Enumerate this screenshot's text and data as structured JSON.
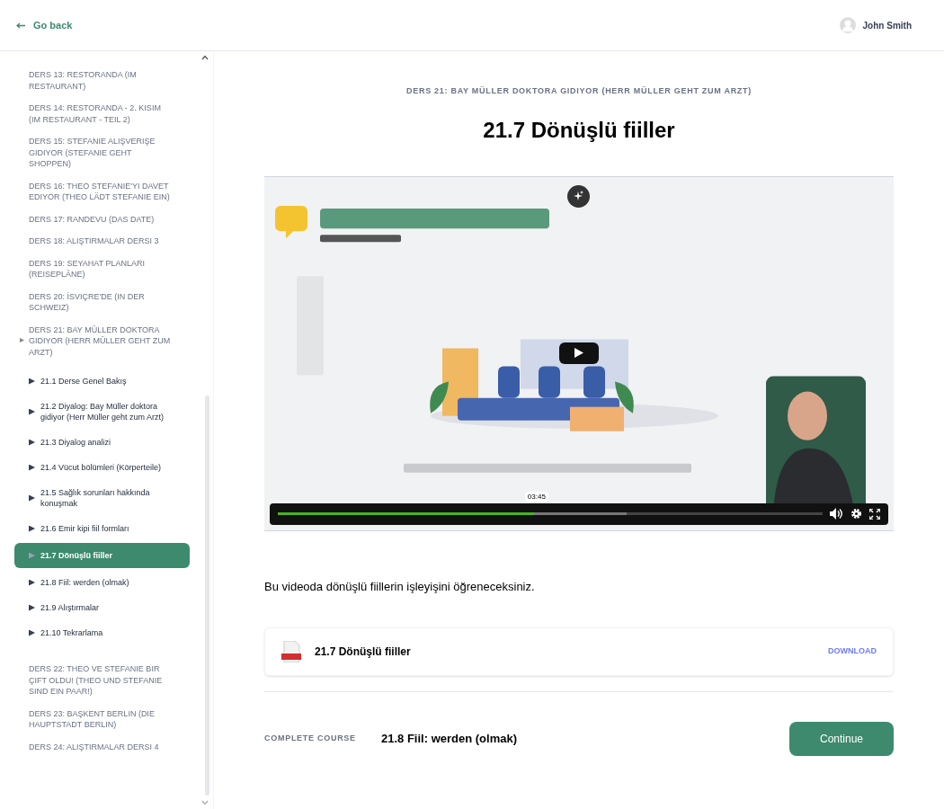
{
  "header": {
    "back_link": "Go back",
    "user_name": "John Smith"
  },
  "sidebar": {
    "lessons": [
      {
        "title": "DERS 13: RESTORANDA (IM RESTAURANT)",
        "expanded": false
      },
      {
        "title": "DERS 14: RESTORANDA - 2. KISIM (IM RESTAURANT - TEIL 2)",
        "expanded": false
      },
      {
        "title": "DERS 15: STEFANIE ALIŞVERIŞE GIDIYOR (STEFANIE GEHT SHOPPEN)",
        "expanded": false
      },
      {
        "title": "DERS 16: THEO STEFANIE'YI DAVET EDIYOR (THEO LÄDT STEFANIE EIN)",
        "expanded": false
      },
      {
        "title": "DERS 17: RANDEVU (DAS DATE)",
        "expanded": false
      },
      {
        "title": "DERS 18: ALIŞTIRMALAR DERSI 3",
        "expanded": false
      },
      {
        "title": "DERS 19: SEYAHAT PLANLARI (REISEPLÄNE)",
        "expanded": false
      },
      {
        "title": "DERS 20: İSVIÇRE'DE (IN DER SCHWEIZ)",
        "expanded": false
      },
      {
        "title": "DERS 21: BAY MÜLLER DOKTORA GIDIYOR (HERR MÜLLER GEHT ZUM ARZT)",
        "expanded": true,
        "children": [
          {
            "title": "21.1 Derse Genel Bakış",
            "selected": false
          },
          {
            "title": "21.2 Diyalog: Bay Müller doktora gidiyor (Herr Müller geht zum Arzt)",
            "selected": false
          },
          {
            "title": "21.3 Diyalog analizi",
            "selected": false
          },
          {
            "title": "21.4 Vücut bölümleri (Körperteile)",
            "selected": false
          },
          {
            "title": "21.5 Sağlık sorunları hakkında konuşmak",
            "selected": false
          },
          {
            "title": "21.6 Emir kipi fiil formları",
            "selected": false
          },
          {
            "title": "21.7 Dönüşlü fiiller",
            "selected": true
          },
          {
            "title": "21.8 Fiil: werden (olmak)",
            "selected": false
          },
          {
            "title": "21.9 Alıştırmalar",
            "selected": false
          },
          {
            "title": "21.10 Tekrarlama",
            "selected": false
          }
        ]
      },
      {
        "title": "DERS 22: THEO VE STEFANIE BIR ÇIFT OLDU! (THEO UND STEFANIE SIND EIN PAAR!)",
        "expanded": false
      },
      {
        "title": "DERS 23: BAŞKENT BERLIN (DIE HAUPTSTADT BERLIN)",
        "expanded": false
      },
      {
        "title": "DERS 24: ALIŞTIRMALAR DERSI 4",
        "expanded": false
      }
    ]
  },
  "lesson": {
    "course_title": "DERS 21: BAY MÜLLER DOKTORA GIDIYOR (HERR MÜLLER GEHT ZUM ARZT)",
    "title": "21.7 Dönüşlü fiiller"
  },
  "video": {
    "kind": "picture",
    "progress": {
      "level": 0.47
    },
    "buffered": {
      "level": 0.64
    },
    "time_tooltip": "03:45"
  },
  "description": "Bu videoda dönüşlü fiillerin işleyişini öğreneceksiniz.",
  "attachment": {
    "name": "21.7 Dönüşlü fiiller",
    "action": "DOWNLOAD"
  },
  "footer": {
    "complete_label": "COMPLETE COURSE",
    "next_lesson": "21.8 Fiil: werden (olmak)",
    "button": "Continue"
  }
}
